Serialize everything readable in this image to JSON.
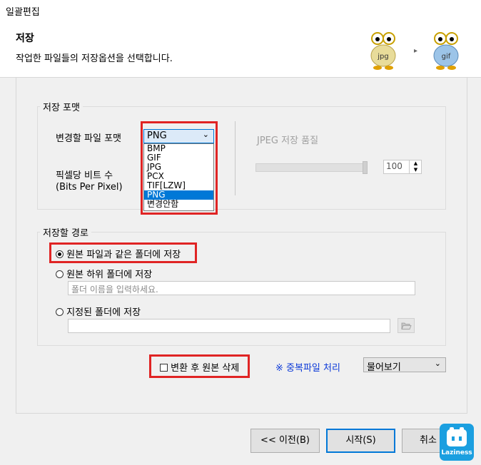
{
  "window": {
    "title": "일괄편집"
  },
  "header": {
    "title": "저장",
    "subtitle": "작업한 파일들의 저장옵션을 선택합니다.",
    "icon_from": "jpg",
    "icon_to": "gif",
    "arrow": "▸"
  },
  "format_group": {
    "label": "저장 포맷",
    "format_label": "변경할 파일 포맷",
    "format_value": "PNG",
    "format_options": [
      "BMP",
      "GIF",
      "JPG",
      "PCX",
      "TIF[LZW]",
      "PNG",
      "변경안함"
    ],
    "format_selected_index": 5,
    "bpp_label_1": "픽셀당 비트 수",
    "bpp_label_2": "(Bits Per Pixel)",
    "jpeg_label": "JPEG 저장 품질",
    "jpeg_value": "100",
    "jpeg_slider_level": 1.0
  },
  "path_group": {
    "label": "저장할 경로",
    "option_same": "원본 파일과 같은 폴더에 저장",
    "option_sub": "원본 하위 폴더에 저장",
    "sub_placeholder": "폴더 이름을 입력하세요.",
    "option_custom": "지정된 폴더에 저장",
    "selected": "same"
  },
  "options": {
    "delete_label": "변환 후 원본 삭제",
    "dup_label": "※ 중복파일 처리",
    "dup_value": "물어보기"
  },
  "buttons": {
    "prev": "<< 이전(B)",
    "start": "시작(S)",
    "cancel": "취소"
  },
  "badge": {
    "text": "Laziness"
  },
  "colors": {
    "highlight": "#e02424",
    "selection": "#0078d7",
    "link": "#0a38d8"
  }
}
